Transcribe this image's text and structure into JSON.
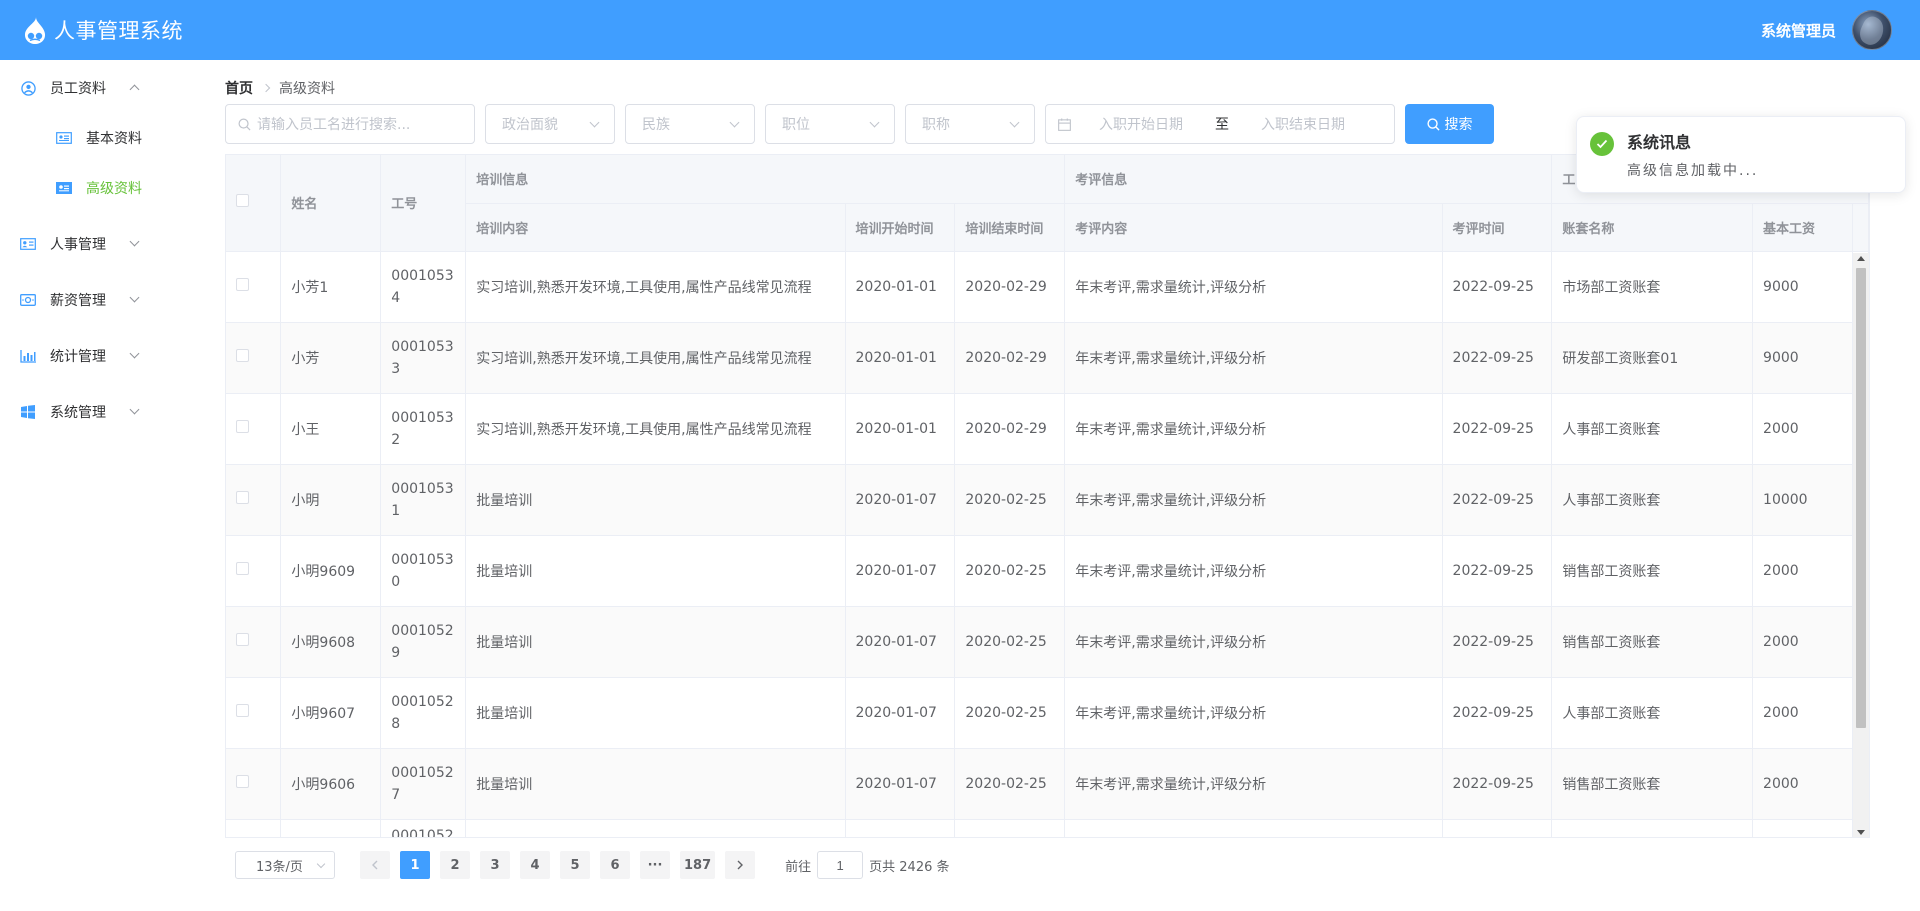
{
  "header": {
    "title": "人事管理系统",
    "user_name": "系统管理员"
  },
  "sidebar": {
    "items": [
      {
        "label": "员工资料",
        "expanded": true,
        "children": [
          {
            "label": "基本资料",
            "active": false
          },
          {
            "label": "高级资料",
            "active": true
          }
        ]
      },
      {
        "label": "人事管理",
        "expanded": false
      },
      {
        "label": "薪资管理",
        "expanded": false
      },
      {
        "label": "统计管理",
        "expanded": false
      },
      {
        "label": "系统管理",
        "expanded": false
      }
    ]
  },
  "breadcrumb": {
    "home": "首页",
    "current": "高级资料"
  },
  "filters": {
    "search_placeholder": "请输入员工名进行搜索...",
    "politic_placeholder": "政治面貌",
    "nation_placeholder": "民族",
    "position_placeholder": "职位",
    "joblevel_placeholder": "职称",
    "date_start_placeholder": "入职开始日期",
    "date_sep": "至",
    "date_end_placeholder": "入职结束日期",
    "search_button": "搜索"
  },
  "table": {
    "group_headers": {
      "training": "培训信息",
      "review": "考评信息",
      "salary": "工"
    },
    "columns": {
      "name": "姓名",
      "work_id": "工号",
      "train_content": "培训内容",
      "train_start": "培训开始时间",
      "train_end": "培训结束时间",
      "review_content": "考评内容",
      "review_date": "考评时间",
      "account_name": "账套名称",
      "basic_salary": "基本工资"
    },
    "rows": [
      {
        "name": "小芳1",
        "work_id_l1": "0001053",
        "work_id_l2": "4",
        "train_content": "实习培训,熟悉开发环境,工具使用,属性产品线常见流程",
        "train_start": "2020-01-01",
        "train_end": "2020-02-29",
        "review_content": "年末考评,需求量统计,评级分析",
        "review_date": "2022-09-25",
        "account_name": "市场部工资账套",
        "basic_salary": "9000"
      },
      {
        "name": "小芳",
        "work_id_l1": "0001053",
        "work_id_l2": "3",
        "train_content": "实习培训,熟悉开发环境,工具使用,属性产品线常见流程",
        "train_start": "2020-01-01",
        "train_end": "2020-02-29",
        "review_content": "年末考评,需求量统计,评级分析",
        "review_date": "2022-09-25",
        "account_name": "研发部工资账套01",
        "basic_salary": "9000"
      },
      {
        "name": "小王",
        "work_id_l1": "0001053",
        "work_id_l2": "2",
        "train_content": "实习培训,熟悉开发环境,工具使用,属性产品线常见流程",
        "train_start": "2020-01-01",
        "train_end": "2020-02-29",
        "review_content": "年末考评,需求量统计,评级分析",
        "review_date": "2022-09-25",
        "account_name": "人事部工资账套",
        "basic_salary": "2000"
      },
      {
        "name": "小明",
        "work_id_l1": "0001053",
        "work_id_l2": "1",
        "train_content": "批量培训",
        "train_start": "2020-01-07",
        "train_end": "2020-02-25",
        "review_content": "年末考评,需求量统计,评级分析",
        "review_date": "2022-09-25",
        "account_name": "人事部工资账套",
        "basic_salary": "10000"
      },
      {
        "name": "小明9609",
        "work_id_l1": "0001053",
        "work_id_l2": "0",
        "train_content": "批量培训",
        "train_start": "2020-01-07",
        "train_end": "2020-02-25",
        "review_content": "年末考评,需求量统计,评级分析",
        "review_date": "2022-09-25",
        "account_name": "销售部工资账套",
        "basic_salary": "2000"
      },
      {
        "name": "小明9608",
        "work_id_l1": "0001052",
        "work_id_l2": "9",
        "train_content": "批量培训",
        "train_start": "2020-01-07",
        "train_end": "2020-02-25",
        "review_content": "年末考评,需求量统计,评级分析",
        "review_date": "2022-09-25",
        "account_name": "销售部工资账套",
        "basic_salary": "2000"
      },
      {
        "name": "小明9607",
        "work_id_l1": "0001052",
        "work_id_l2": "8",
        "train_content": "批量培训",
        "train_start": "2020-01-07",
        "train_end": "2020-02-25",
        "review_content": "年末考评,需求量统计,评级分析",
        "review_date": "2022-09-25",
        "account_name": "人事部工资账套",
        "basic_salary": "2000"
      },
      {
        "name": "小明9606",
        "work_id_l1": "0001052",
        "work_id_l2": "7",
        "train_content": "批量培训",
        "train_start": "2020-01-07",
        "train_end": "2020-02-25",
        "review_content": "年末考评,需求量统计,评级分析",
        "review_date": "2022-09-25",
        "account_name": "销售部工资账套",
        "basic_salary": "2000"
      }
    ],
    "partial_row": {
      "work_id_l1": "0001052"
    }
  },
  "pagination": {
    "page_size": "13条/页",
    "pages": [
      "1",
      "2",
      "3",
      "4",
      "5",
      "6",
      "···",
      "187"
    ],
    "current": "1",
    "goto_label": "前往",
    "goto_value": "1",
    "total_text": "页共 2426 条"
  },
  "notification": {
    "title": "系统讯息",
    "message": "高级信息加载中..."
  },
  "colors": {
    "primary": "#409eff",
    "success": "#67c23a",
    "border": "#ebeef5"
  },
  "icons": {
    "logo": "drupal-drop-icon",
    "menu_employee": "user-circle-icon",
    "menu_basic": "id-card-icon",
    "menu_advanced": "id-card-icon",
    "menu_personnel": "address-card-icon",
    "menu_salary": "money-icon",
    "menu_stats": "bar-chart-icon",
    "menu_system": "windows-icon",
    "search": "search-icon",
    "calendar": "calendar-icon",
    "notify": "check-circle-icon"
  }
}
